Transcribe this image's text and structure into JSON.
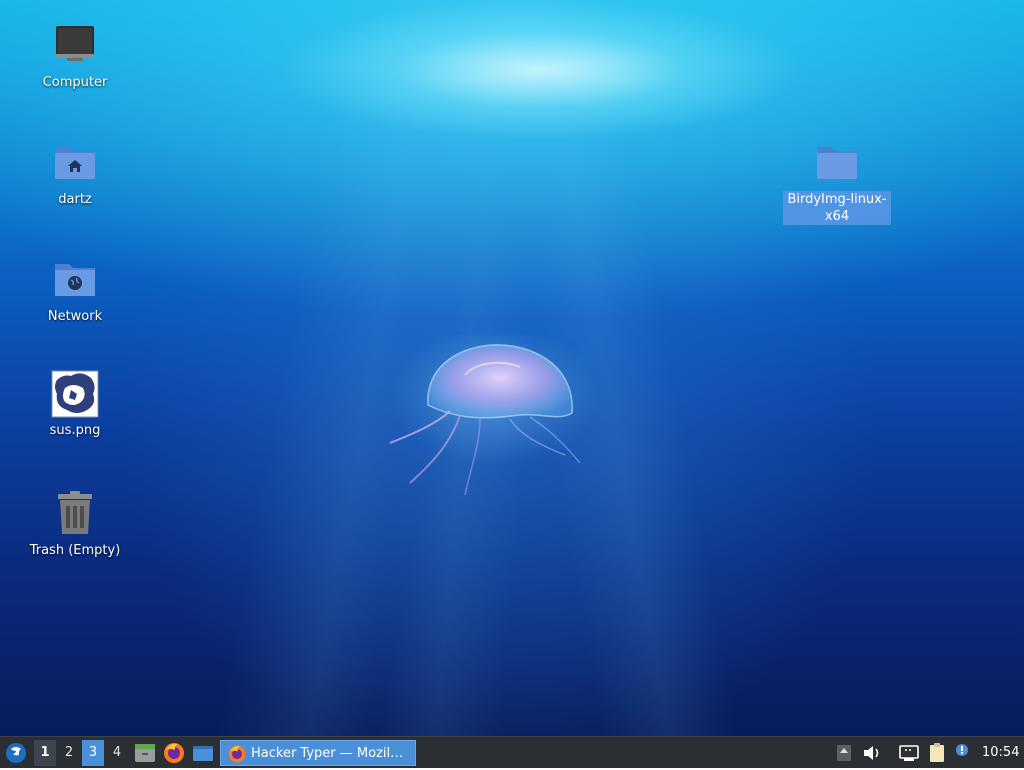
{
  "desktop": {
    "icons": [
      {
        "label": "Computer",
        "icon": "computer-icon"
      },
      {
        "label": "dartz",
        "icon": "home-folder-icon"
      },
      {
        "label": "Network",
        "icon": "network-folder-icon"
      },
      {
        "label": "sus.png",
        "icon": "image-file-icon"
      },
      {
        "label": "Trash (Empty)",
        "icon": "trash-icon"
      },
      {
        "label": "BirdyImg-linux-x64",
        "icon": "folder-icon",
        "selected": true
      }
    ],
    "wallpaper": "jellyfish-underwater"
  },
  "taskbar": {
    "start_icon": "whisker-menu-icon",
    "workspaces": [
      "1",
      "2",
      "3",
      "4"
    ],
    "active_workspace": "1",
    "current_workspace": "3",
    "launchers": [
      "file-manager-icon",
      "firefox-icon",
      "desktop-icon"
    ],
    "window_button": {
      "label": "Hacker Typer — Mozil…",
      "icon": "firefox-icon"
    },
    "tray": [
      "tray-expand-icon",
      "volume-icon",
      "network-icon",
      "clipboard-icon",
      "notification-icon"
    ],
    "clock": "10:54"
  },
  "colors": {
    "taskbar_bg": "#2b2e33",
    "accent": "#4a90d9",
    "selection": "#5a96e6"
  }
}
